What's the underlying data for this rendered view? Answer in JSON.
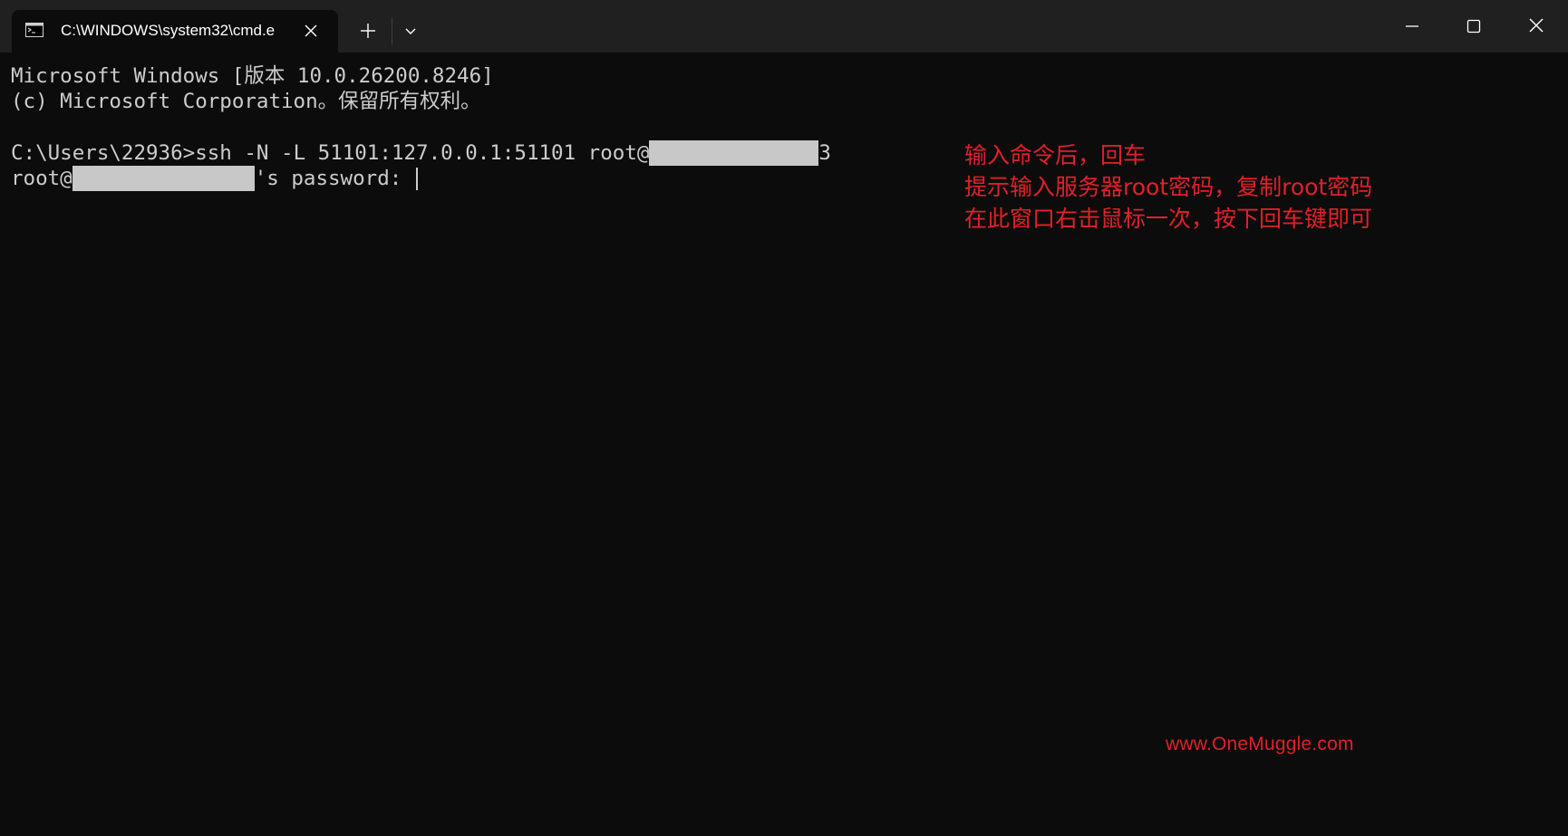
{
  "window": {
    "tab_title": "C:\\WINDOWS\\system32\\cmd.e",
    "tab_icon": "terminal-icon",
    "close_tab_icon": "close-icon",
    "new_tab_icon": "plus-icon",
    "dropdown_icon": "chevron-down-icon",
    "controls": {
      "minimize_icon": "minimize-icon",
      "maximize_icon": "maximize-icon",
      "close_icon": "close-icon"
    }
  },
  "terminal": {
    "lines": [
      "Microsoft Windows [版本 10.0.26200.8246]",
      "(c) Microsoft Corporation。保留所有权利。",
      ""
    ],
    "command": {
      "prompt": "C:\\Users\\22936>",
      "text": "ssh -N -L 51101:127.0.0.1:51101 root@",
      "tail": "3"
    },
    "password_prompt": {
      "prefix": "root@",
      "suffix": "'s password: "
    },
    "text_color": "#cccccc",
    "background": "#0c0c0c"
  },
  "annotation": {
    "lines": [
      "输入命令后，回车",
      "提示输入服务器root密码，复制root密码",
      "在此窗口右击鼠标一次，按下回车键即可"
    ],
    "color": "#e0202a"
  },
  "watermark": {
    "text": "www.OneMuggle.com"
  }
}
